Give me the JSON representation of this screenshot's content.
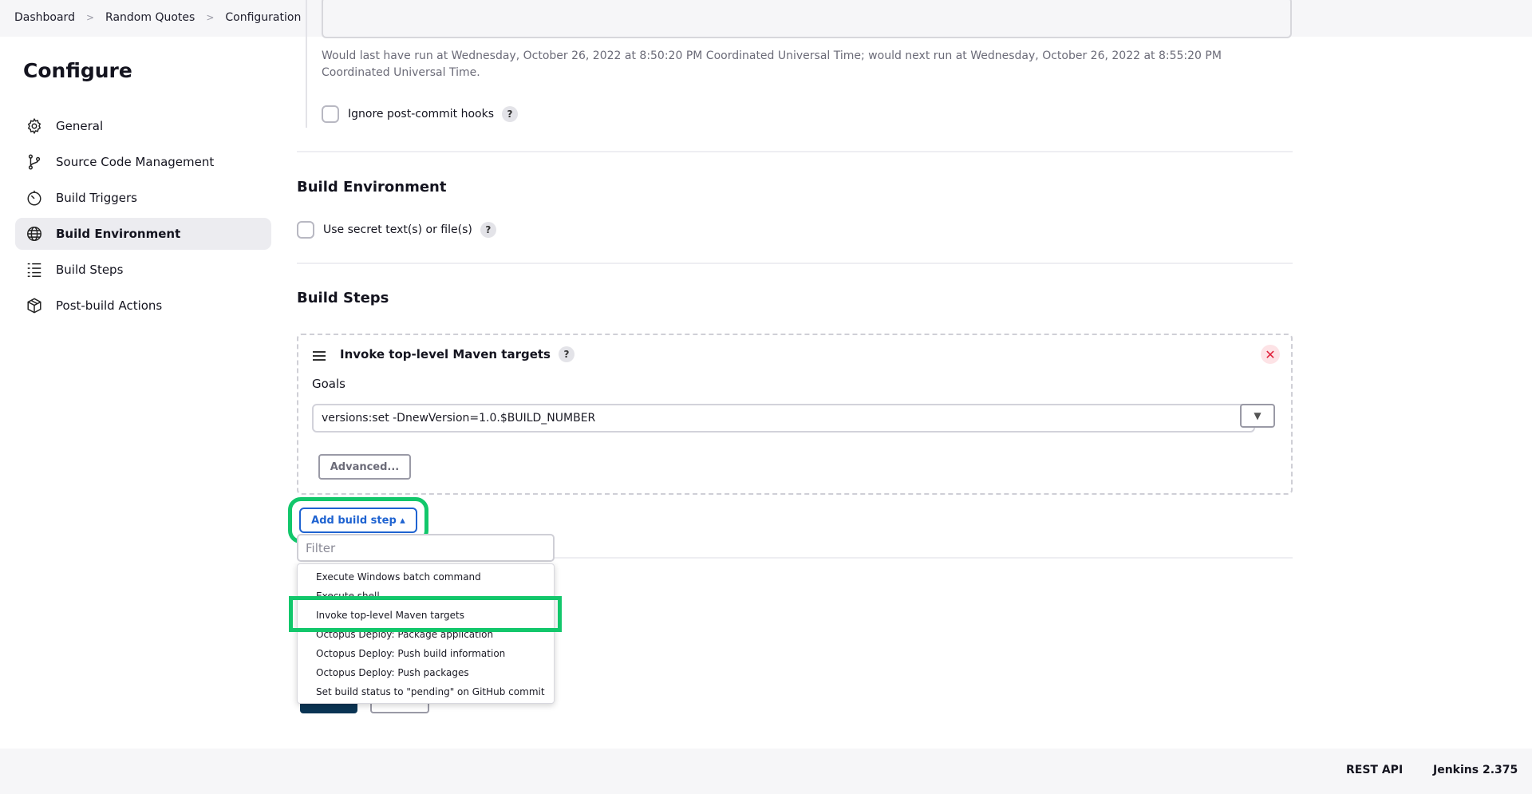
{
  "breadcrumb": [
    "Dashboard",
    "Random Quotes",
    "Configuration"
  ],
  "sidebar": {
    "title": "Configure",
    "items": [
      {
        "label": "General",
        "icon": "gear-icon",
        "active": false
      },
      {
        "label": "Source Code Management",
        "icon": "branch-icon",
        "active": false
      },
      {
        "label": "Build Triggers",
        "icon": "timer-icon",
        "active": false
      },
      {
        "label": "Build Environment",
        "icon": "globe-icon",
        "active": true
      },
      {
        "label": "Build Steps",
        "icon": "list-icon",
        "active": false
      },
      {
        "label": "Post-build Actions",
        "icon": "package-icon",
        "active": false
      }
    ]
  },
  "triggers": {
    "schedule_note": "Would last have run at Wednesday, October 26, 2022 at 8:50:20 PM Coordinated Universal Time; would next run at Wednesday, October 26, 2022 at 8:55:20 PM Coordinated Universal Time.",
    "ignore_hooks_label": "Ignore post-commit hooks",
    "help_label": "?"
  },
  "build_environment": {
    "title": "Build Environment",
    "secret_label": "Use secret text(s) or file(s)"
  },
  "build_steps": {
    "title": "Build Steps",
    "step_title": "Invoke top-level Maven targets",
    "close_label": "✕",
    "goals_label": "Goals",
    "goals_value": "versions:set -DnewVersion=1.0.$BUILD_NUMBER",
    "dropdown_label": "▼",
    "advanced_label": "Advanced...",
    "add_step_label": "Add build step ▴"
  },
  "menu": {
    "filter_placeholder": "Filter",
    "items": [
      "Execute Windows batch command",
      "Execute shell",
      "Invoke top-level Maven targets",
      "Octopus Deploy: Package application",
      "Octopus Deploy: Push build information",
      "Octopus Deploy: Push packages",
      "Set build status to \"pending\" on GitHub commit"
    ]
  },
  "footer": {
    "rest_api": "REST API",
    "version": "Jenkins 2.375"
  },
  "colors": {
    "highlight": "#12c76b",
    "accent_blue": "#1f63d1",
    "active_bg": "#ececf0",
    "close_red": "#e0203a"
  }
}
